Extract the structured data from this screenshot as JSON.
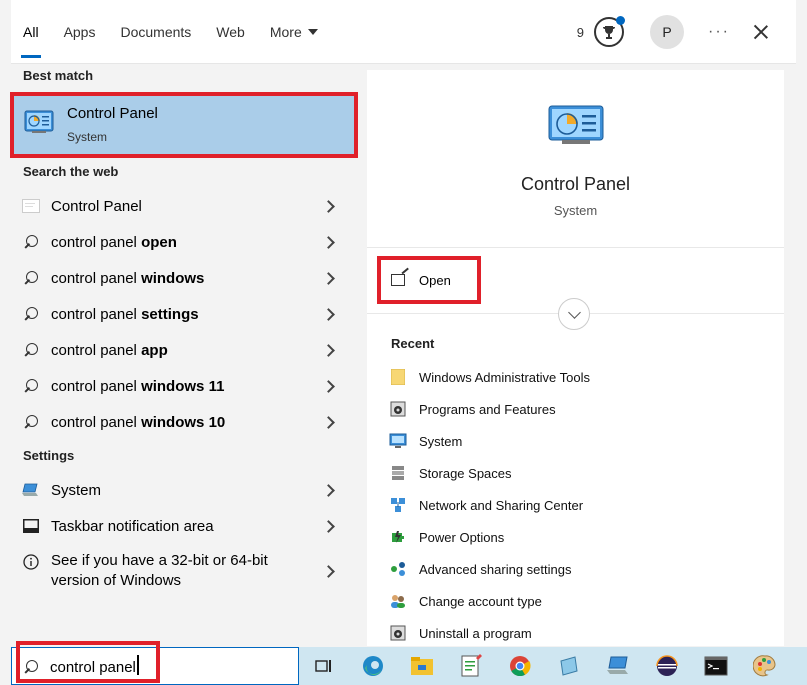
{
  "tabs": [
    {
      "label": "All",
      "active": true
    },
    {
      "label": "Apps",
      "active": false
    },
    {
      "label": "Documents",
      "active": false
    },
    {
      "label": "Web",
      "active": false
    },
    {
      "label": "More",
      "active": false
    }
  ],
  "header_right": {
    "points": "9",
    "avatar_initial": "P",
    "more_options": "···"
  },
  "left": {
    "best_match_header": "Best match",
    "best_match": {
      "title": "Control Panel",
      "subtitle": "System",
      "icon": "control-panel-icon"
    },
    "search_web_header": "Search the web",
    "web_results": [
      {
        "prefix": "Control Panel",
        "bold": "",
        "icon": "web-page-icon"
      },
      {
        "prefix": "control panel ",
        "bold": "open",
        "icon": "search-icon"
      },
      {
        "prefix": "control panel ",
        "bold": "windows",
        "icon": "search-icon"
      },
      {
        "prefix": "control panel ",
        "bold": "settings",
        "icon": "search-icon"
      },
      {
        "prefix": "control panel ",
        "bold": "app",
        "icon": "search-icon"
      },
      {
        "prefix": "control panel ",
        "bold": "windows 11",
        "icon": "search-icon"
      },
      {
        "prefix": "control panel ",
        "bold": "windows 10",
        "icon": "search-icon"
      }
    ],
    "settings_header": "Settings",
    "settings_results": [
      {
        "label": "System",
        "icon": "laptop-icon"
      },
      {
        "label": "Taskbar notification area",
        "icon": "taskbar-icon"
      },
      {
        "label_line1": "See if you have a 32-bit or 64-bit",
        "label_line2": "version of Windows",
        "icon": "info-icon"
      }
    ]
  },
  "right": {
    "title": "Control Panel",
    "subtitle": "System",
    "open_label": "Open",
    "recent_header": "Recent",
    "recent": [
      {
        "label": "Windows Administrative Tools",
        "icon": "folder-icon"
      },
      {
        "label": "Programs and Features",
        "icon": "programs-icon"
      },
      {
        "label": "System",
        "icon": "monitor-icon"
      },
      {
        "label": "Storage Spaces",
        "icon": "storage-icon"
      },
      {
        "label": "Network and Sharing Center",
        "icon": "network-icon"
      },
      {
        "label": "Power Options",
        "icon": "power-icon"
      },
      {
        "label": "Advanced sharing settings",
        "icon": "sharing-icon"
      },
      {
        "label": "Change account type",
        "icon": "users-icon"
      },
      {
        "label": "Uninstall a program",
        "icon": "programs-icon"
      }
    ]
  },
  "search": {
    "value": "control panel"
  },
  "taskbar": [
    {
      "icon": "task-view-icon"
    },
    {
      "icon": "edge-icon"
    },
    {
      "icon": "file-explorer-icon"
    },
    {
      "icon": "notepad-icon"
    },
    {
      "icon": "chrome-icon"
    },
    {
      "icon": "app-icon"
    },
    {
      "icon": "laptop-app-icon"
    },
    {
      "icon": "eclipse-icon"
    },
    {
      "icon": "terminal-icon"
    },
    {
      "icon": "paint-icon"
    }
  ],
  "colors": {
    "accent": "#0067c0",
    "highlight": "#aacde9",
    "annotation": "#e0202a",
    "taskbar": "#cfe6f1"
  }
}
